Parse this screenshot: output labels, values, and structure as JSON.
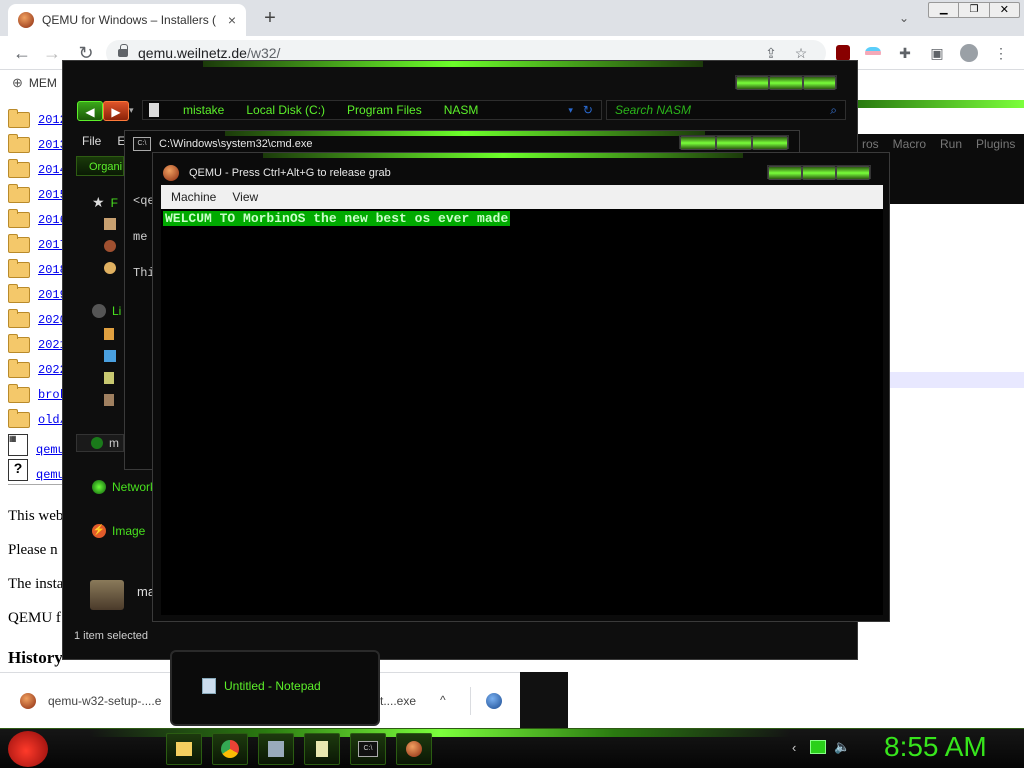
{
  "chrome": {
    "tab_title": "QEMU for Windows – Installers (",
    "tab_close": "×",
    "new_tab": "+",
    "url_host": "qemu.weilnetz.de",
    "url_path": "/w32/",
    "bookmark": "MEM"
  },
  "page": {
    "dirs": [
      "2012",
      "2013",
      "2014",
      "2015",
      "2016",
      "2017",
      "2018",
      "2019",
      "2020",
      "2021",
      "2022",
      "brok",
      "old/"
    ],
    "files": [
      "qemu",
      "qemu"
    ],
    "para1": "This web",
    "para2": "Please n",
    "para3": "The insta",
    "para4": "QEMU f",
    "heading": "History"
  },
  "explorer": {
    "breadcrumbs": [
      "mistake",
      "Local Disk (C:)",
      "Program Files",
      "NASM"
    ],
    "search_placeholder": "Search NASM",
    "menu_file": "File",
    "menu_edit": "E",
    "organize": "Organi",
    "side_fav": "F",
    "side_lib": "Li",
    "side_home": "m",
    "network": "Network",
    "image": "Image",
    "bottom_label": "ma",
    "status": "1 item selected"
  },
  "cmd": {
    "title": "C:\\Windows\\system32\\cmd.exe",
    "lines": [
      "<qe",
      "me",
      "Thi"
    ]
  },
  "qemu": {
    "title": "QEMU - Press Ctrl+Alt+G to release grab",
    "menu": [
      "Machine",
      "View"
    ],
    "banner": "WELCUM TO MorbinOS the new best os ever made"
  },
  "rightapp": {
    "menu": [
      "ros",
      "Macro",
      "Run",
      "Plugins"
    ]
  },
  "downloads": {
    "item1": "qemu-w32-setup-....e",
    "item2": "t....exe",
    "caret": "^"
  },
  "taskbar": {
    "clock": "8:55 AM",
    "notepad_preview": "Untitled - Notepad"
  },
  "colors": {
    "accent_green": "#5cf02a",
    "qemu_banner_bg": "#00aa00",
    "clock_green": "#37e51c"
  }
}
